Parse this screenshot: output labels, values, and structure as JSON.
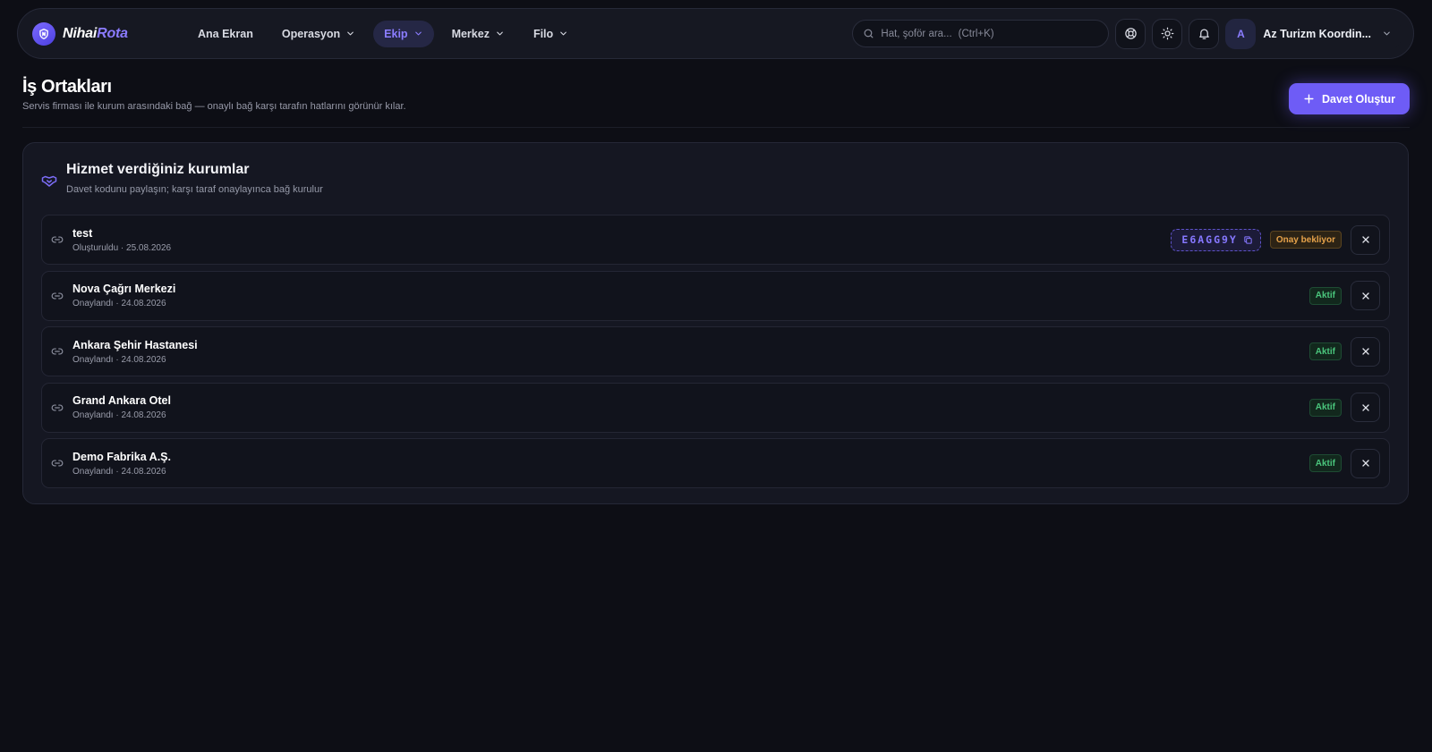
{
  "app": {
    "brand_part1": "Nihai",
    "brand_part2": "Rota"
  },
  "nav": {
    "items": [
      {
        "label": "Ana Ekran",
        "dropdown": false,
        "active": false
      },
      {
        "label": "Operasyon",
        "dropdown": true,
        "active": false
      },
      {
        "label": "Ekip",
        "dropdown": true,
        "active": true
      },
      {
        "label": "Merkez",
        "dropdown": true,
        "active": false
      },
      {
        "label": "Filo",
        "dropdown": true,
        "active": false
      }
    ]
  },
  "search": {
    "placeholder": "Hat, şoför ara...",
    "shortcut": "(Ctrl+K)"
  },
  "toolbar": {
    "icons": [
      "support-icon",
      "sun-icon",
      "bell-icon"
    ]
  },
  "user": {
    "initial": "A",
    "name": "Az Turizm Koordin..."
  },
  "page": {
    "title": "İş Ortakları",
    "subtitle": "Servis firması ile kurum arasındaki bağ — onaylı bağ karşı tarafın hatlarını görünür kılar.",
    "invite_button": "Davet Oluştur"
  },
  "partners_card": {
    "title": "Hizmet verdiğiniz kurumlar",
    "subtitle": "Davet kodunu paylaşın; karşı taraf onaylayınca bağ kurulur",
    "rows": [
      {
        "name": "test",
        "meta": "Oluşturuldu · 25.08.2026",
        "code": "E6AGG9Y",
        "status": "Onay bekliyor",
        "status_type": "pending"
      },
      {
        "name": "Nova Çağrı Merkezi",
        "meta": "Onaylandı · 24.08.2026",
        "code": "",
        "status": "Aktif",
        "status_type": "active"
      },
      {
        "name": "Ankara Şehir Hastanesi",
        "meta": "Onaylandı · 24.08.2026",
        "code": "",
        "status": "Aktif",
        "status_type": "active"
      },
      {
        "name": "Grand Ankara Otel",
        "meta": "Onaylandı · 24.08.2026",
        "code": "",
        "status": "Aktif",
        "status_type": "active"
      },
      {
        "name": "Demo Fabrika A.Ş.",
        "meta": "Onaylandı · 24.08.2026",
        "code": "",
        "status": "Aktif",
        "status_type": "active"
      }
    ]
  },
  "colors": {
    "background": "#0d0e15",
    "accent": "#6e5cf6",
    "pending": "#e6a24a",
    "active": "#4ac57c"
  }
}
